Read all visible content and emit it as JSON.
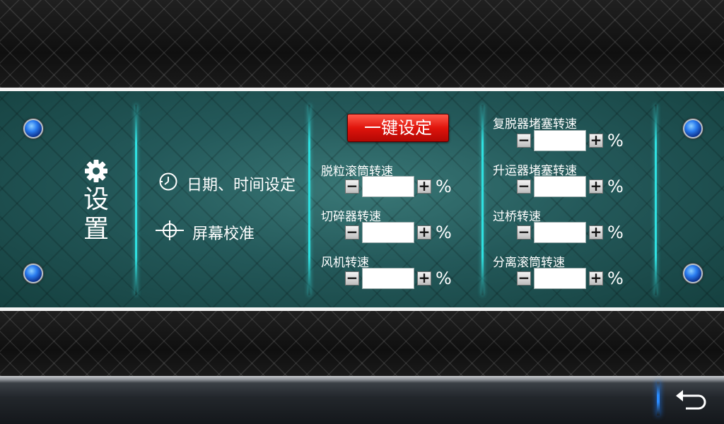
{
  "colors": {
    "panel_teal": "#1d4e4d",
    "divider_cyan": "#2fe0e0",
    "one_key_red": "#e0140c",
    "led_blue": "#2a7df0"
  },
  "sidebar": {
    "icon": "gear-icon",
    "title_chars": [
      "设",
      "置"
    ]
  },
  "menu": {
    "datetime": {
      "icon": "clock-icon",
      "label": "日期、时间设定"
    },
    "calibration": {
      "icon": "crosshair-icon",
      "label": "屏幕校准"
    }
  },
  "one_key_button": {
    "label": "一键设定"
  },
  "params": [
    {
      "label": "脱粒滚筒转速",
      "value": "",
      "unit": "%"
    },
    {
      "label": "切碎器转速",
      "value": "",
      "unit": "%"
    },
    {
      "label": "风机转速",
      "value": "",
      "unit": "%"
    },
    {
      "label": "复脱器堵塞转速",
      "value": "",
      "unit": "%"
    },
    {
      "label": "升运器堵塞转速",
      "value": "",
      "unit": "%"
    },
    {
      "label": "过桥转速",
      "value": "",
      "unit": "%"
    },
    {
      "label": "分离滚筒转速",
      "value": "",
      "unit": "%"
    }
  ],
  "stepper": {
    "minus": "−",
    "plus": "+"
  },
  "footer": {
    "back_icon": "return-arrow-icon"
  }
}
